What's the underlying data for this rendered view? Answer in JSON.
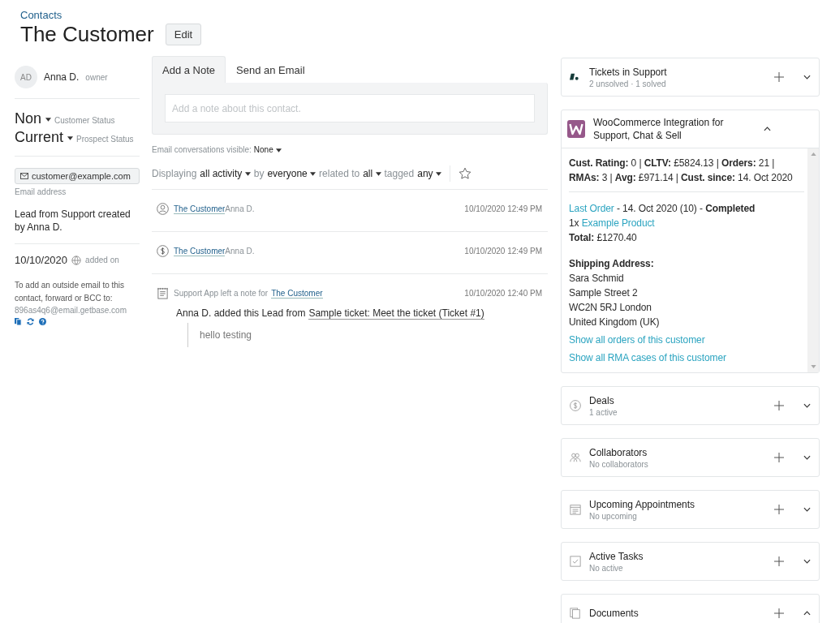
{
  "breadcrumb": "Contacts",
  "title": "The Customer",
  "edit_button": "Edit",
  "owner": {
    "initials": "AD",
    "name": "Anna D.",
    "role": "owner"
  },
  "statuses": [
    {
      "value": "Non",
      "label": "Customer Status"
    },
    {
      "value": "Current",
      "label": "Prospect Status"
    }
  ],
  "email": {
    "value": "customer@example.com",
    "label": "Email address"
  },
  "lead_source": "Lead from Support created by Anna D.",
  "added": {
    "date": "10/10/2020",
    "label": "added on"
  },
  "forward": {
    "text": "To add an outside email to this contact, forward or BCC to:",
    "address": "896as4q6@email.getbase.com"
  },
  "tabs": [
    {
      "label": "Add a Note",
      "selected": true
    },
    {
      "label": "Send an Email",
      "selected": false
    }
  ],
  "note": {
    "placeholder": "Add a note about this contact."
  },
  "email_visibility": {
    "label": "Email conversations visible:",
    "value": "None"
  },
  "filters": [
    {
      "prefix": "Displaying",
      "value": "all activity"
    },
    {
      "prefix": "by",
      "value": "everyone"
    },
    {
      "prefix": "related to",
      "value": "all"
    },
    {
      "prefix": "tagged",
      "value": "any"
    }
  ],
  "activities": [
    {
      "kind": "contact",
      "link": "The Customer",
      "author": "Anna D.",
      "time": "10/10/2020 12:49 PM"
    },
    {
      "kind": "deal",
      "link": "The Customer",
      "author": "Anna D.",
      "time": "10/10/2020 12:49 PM"
    },
    {
      "kind": "note",
      "source": "Support App left a note for",
      "link": "The Customer",
      "time": "10/10/2020 12:40 PM",
      "body": "Anna D. added this Lead from",
      "body_link": "Sample ticket: Meet the ticket (Ticket #1)",
      "quote": "hello testing"
    }
  ],
  "tickets": {
    "title": "Tickets in Support",
    "subtitle": "2 unsolved · 1 solved",
    "expanded": false
  },
  "woocommerce": {
    "title": "WooCommerce Integration for Support, Chat & Sell",
    "expanded": true,
    "stats": "**Cust. Rating:** 0  | **CLTV:** £5824.13  | **Orders:** 21  | **RMAs:** 3  | **Avg:** £971.14  |  **Cust. since:** 14. Oct 2020",
    "order_link": "Last Order",
    "order_text": " - 14. Oct 2020 (10) - **Completed**",
    "product_qty": "1x",
    "product_link": "Example Product",
    "total": "**Total:** £1270.40",
    "shipping_heading": "Shipping Address:",
    "address": [
      "Sara Schmid",
      "Sample Street 2",
      "WC2N 5RJ London",
      "United Kingdom (UK)"
    ],
    "links": [
      "Show all orders of this customer",
      "Show all RMA cases of this customer"
    ]
  },
  "widgets": [
    {
      "kind": "deals",
      "title": "Deals",
      "subtitle": "1 active",
      "expanded": false
    },
    {
      "kind": "collaborators",
      "title": "Collaborators",
      "subtitle": "No collaborators",
      "expanded": false
    },
    {
      "kind": "appointments",
      "title": "Upcoming Appointments",
      "subtitle": "No upcoming",
      "expanded": false
    },
    {
      "kind": "tasks",
      "title": "Active Tasks",
      "subtitle": "No active",
      "expanded": false
    },
    {
      "kind": "documents",
      "title": "Documents",
      "expanded": true
    }
  ]
}
